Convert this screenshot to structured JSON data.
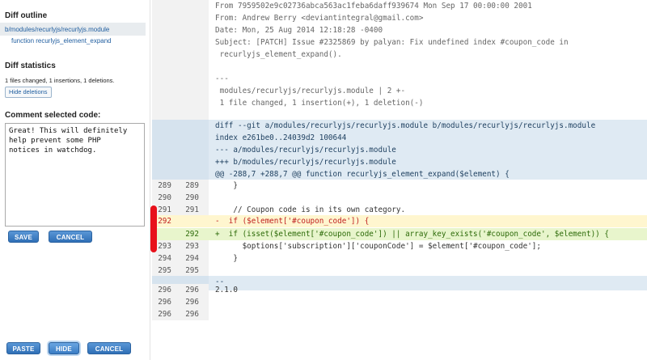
{
  "sidebar": {
    "outline_title": "Diff outline",
    "outline_file": "b/modules/recurlyjs/recurlyjs.module",
    "outline_function": "function recurlyjs_element_expand",
    "stats_title": "Diff statistics",
    "stats_text": "1 files changed, 1 insertions, 1 deletions.",
    "hide_deletions_label": "Hide deletions",
    "comment_title": "Comment selected code:",
    "comment_value": "Great! This will definitely\nhelp prevent some PHP\nnotices in watchdog.",
    "save_label": "SAVE",
    "cancel_label": "CANCEL",
    "paste_label": "PASTE",
    "hide_label": "HIDE",
    "cancel2_label": "CANCEL"
  },
  "diff": {
    "rows": [
      {
        "old": "",
        "new": "",
        "code": "From 7959502e9c02736abca563ac1feba6daff939674 Mon Sep 17 00:00:00 2001",
        "kind": "hdr"
      },
      {
        "old": "",
        "new": "",
        "code": "From: Andrew Berry <deviantintegral@gmail.com>",
        "kind": "hdr"
      },
      {
        "old": "",
        "new": "",
        "code": "Date: Mon, 25 Aug 2014 12:18:28 -0400",
        "kind": "hdr"
      },
      {
        "old": "",
        "new": "",
        "code": "Subject: [PATCH] Issue #2325869 by palyan: Fix undefined index #coupon_code in",
        "kind": "hdr"
      },
      {
        "old": "",
        "new": "",
        "code": " recurlyjs_element_expand().",
        "kind": "hdr"
      },
      {
        "old": "",
        "new": "",
        "code": "",
        "kind": "hdr"
      },
      {
        "old": "",
        "new": "",
        "code": "---",
        "kind": "hdr"
      },
      {
        "old": "",
        "new": "",
        "code": " modules/recurlyjs/recurlyjs.module | 2 +-",
        "kind": "hdr"
      },
      {
        "old": "",
        "new": "",
        "code": " 1 file changed, 1 insertion(+), 1 deletion(-)",
        "kind": "hdr"
      },
      {
        "old": "",
        "new": "",
        "code": "",
        "kind": "hdr"
      },
      {
        "old": "",
        "new": "",
        "code": "diff --git a/modules/recurlyjs/recurlyjs.module b/modules/recurlyjs/recurlyjs.module",
        "kind": "info"
      },
      {
        "old": "",
        "new": "",
        "code": "index e261be0..24039d2 100644",
        "kind": "info"
      },
      {
        "old": "",
        "new": "",
        "code": "--- a/modules/recurlyjs/recurlyjs.module",
        "kind": "info"
      },
      {
        "old": "",
        "new": "",
        "code": "+++ b/modules/recurlyjs/recurlyjs.module",
        "kind": "info"
      },
      {
        "old": "",
        "new": "",
        "code": "@@ -288,7 +288,7 @@ function recurlyjs_element_expand($element) {",
        "kind": "info"
      },
      {
        "old": "289",
        "new": "289",
        "code": "    }",
        "kind": "ctx"
      },
      {
        "old": "290",
        "new": "290",
        "code": "",
        "kind": "ctx"
      },
      {
        "old": "291",
        "new": "291",
        "code": "    // Coupon code is in its own category.",
        "kind": "ctx"
      },
      {
        "old": "292",
        "new": "",
        "code": "-  if ($element['#coupon_code']) {",
        "kind": "del"
      },
      {
        "old": "",
        "new": "292",
        "code": "+  if (isset($element['#coupon_code']) || array_key_exists('#coupon_code', $element)) {",
        "kind": "add"
      },
      {
        "old": "293",
        "new": "293",
        "code": "      $options['subscription']['couponCode'] = $element['#coupon_code'];",
        "kind": "ctx"
      },
      {
        "old": "294",
        "new": "294",
        "code": "    }",
        "kind": "ctx"
      },
      {
        "old": "295",
        "new": "295",
        "code": "",
        "kind": "ctx"
      },
      {
        "old": "",
        "new": "",
        "code": "--",
        "kind": "info"
      },
      {
        "old": "296",
        "new": "296",
        "code": "2.1.0",
        "kind": "ctx"
      },
      {
        "old": "296",
        "new": "296",
        "code": "",
        "kind": "ctx"
      },
      {
        "old": "296",
        "new": "296",
        "code": "",
        "kind": "ctx"
      }
    ]
  }
}
